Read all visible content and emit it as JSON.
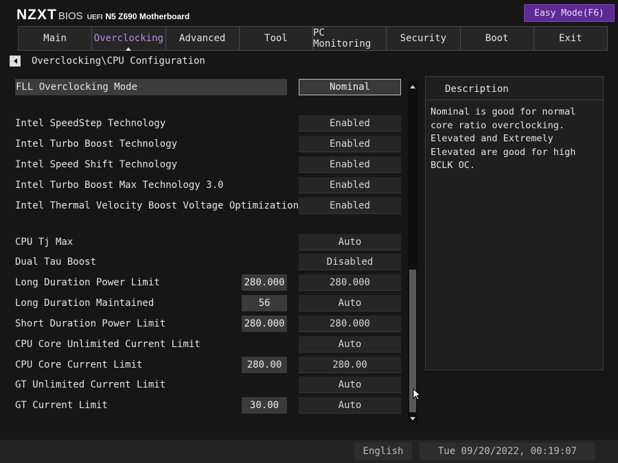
{
  "header": {
    "brand": "NZXT",
    "bios": "BIOS",
    "uefi": "UEFI",
    "board": "N5 Z690 Motherboard",
    "easy_mode": "Easy Mode(F6)"
  },
  "tabs": [
    {
      "label": "Main"
    },
    {
      "label": "Overclocking"
    },
    {
      "label": "Advanced"
    },
    {
      "label": "Tool"
    },
    {
      "label": "PC Monitoring"
    },
    {
      "label": "Security"
    },
    {
      "label": "Boot"
    },
    {
      "label": "Exit"
    }
  ],
  "breadcrumb": "Overclocking\\CPU Configuration",
  "settings": [
    {
      "label": "FLL Overclocking Mode",
      "value": "Nominal"
    },
    {
      "label": "Intel SpeedStep Technology",
      "value": "Enabled"
    },
    {
      "label": "Intel Turbo Boost Technology",
      "value": "Enabled"
    },
    {
      "label": "Intel Speed Shift Technology",
      "value": "Enabled"
    },
    {
      "label": "Intel Turbo Boost Max Technology 3.0",
      "value": "Enabled"
    },
    {
      "label": "Intel Thermal Velocity Boost Voltage Optimizations",
      "value": "Enabled"
    },
    {
      "label": "CPU Tj Max",
      "value": "Auto"
    },
    {
      "label": "Dual Tau Boost",
      "value": "Disabled"
    },
    {
      "label": "Long Duration Power Limit",
      "number": "280.000",
      "value": "280.000"
    },
    {
      "label": "Long Duration Maintained",
      "number": "56",
      "value": "Auto"
    },
    {
      "label": "Short Duration Power Limit",
      "number": "280.000",
      "value": "280.000"
    },
    {
      "label": "CPU Core Unlimited Current Limit",
      "value": "Auto"
    },
    {
      "label": "CPU Core Current Limit",
      "number": "280.00",
      "value": "280.00"
    },
    {
      "label": "GT Unlimited Current Limit",
      "value": "Auto"
    },
    {
      "label": "GT Current Limit",
      "number": "30.00",
      "value": "Auto"
    }
  ],
  "description": {
    "title": "Description",
    "text": "Nominal is good for normal core ratio overclocking. Elevated and Extremely Elevated are good for high BCLK OC."
  },
  "footer": {
    "language": "English",
    "datetime": "Tue 09/20/2022, 00:19:07"
  },
  "colors": {
    "accent_purple": "#5e2a96",
    "active_tab_text": "#b98be8",
    "background": "#161616"
  }
}
